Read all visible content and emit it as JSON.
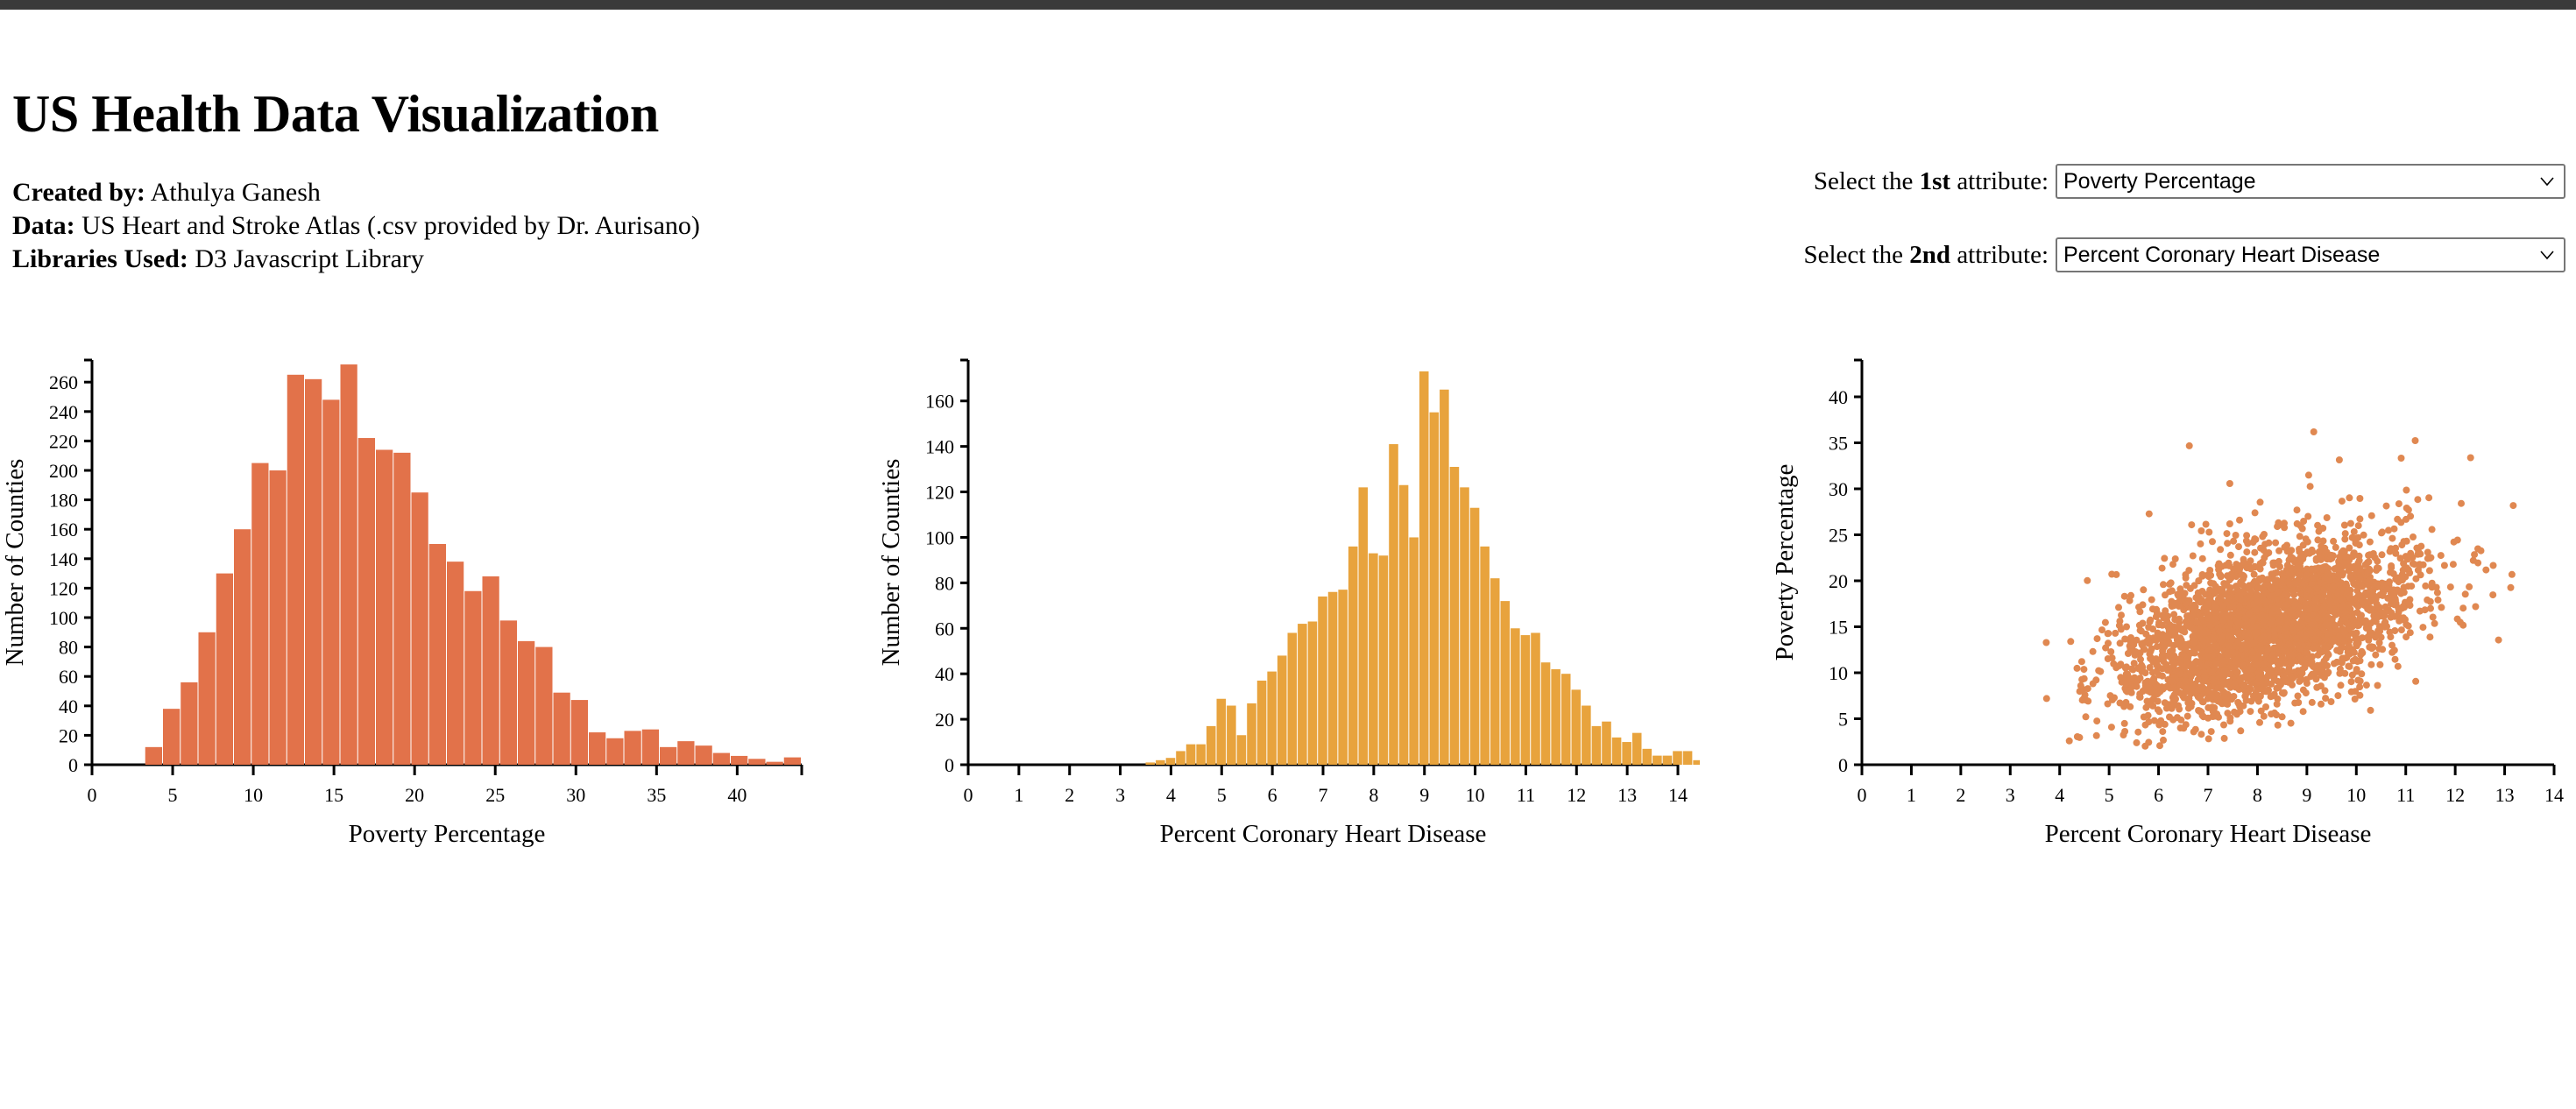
{
  "page": {
    "title": "US Health Data Visualization"
  },
  "meta": {
    "created_by_label": "Created by:",
    "created_by_value": " Athulya Ganesh",
    "data_label": "Data:",
    "data_value": " US Heart and Stroke Atlas (.csv provided by Dr. Aurisano)",
    "libraries_label": "Libraries Used:",
    "libraries_value": " D3 Javascript Library"
  },
  "controls": {
    "first": {
      "label_pre": "Select the ",
      "label_bold": "1st",
      "label_post": " attribute:",
      "value": "Poverty Percentage",
      "caret": "chevron-down-icon"
    },
    "second": {
      "label_pre": "Select the ",
      "label_bold": "2nd",
      "label_post": " attribute:",
      "value": "Percent Coronary Heart Disease",
      "caret": "chevron-down-icon"
    }
  },
  "colors": {
    "hist1": "#e2724a",
    "hist2": "#e8a33d",
    "scatter": "#e08851",
    "axis": "#000000",
    "browser_edge": "#3a3a3a"
  },
  "chart_data": [
    {
      "id": "hist1",
      "type": "bar",
      "title": "",
      "xlabel": "Poverty Percentage",
      "ylabel": "Number of Counties",
      "xlim": [
        0,
        44
      ],
      "ylim": [
        0,
        275
      ],
      "xticks": [
        0,
        5,
        10,
        15,
        20,
        25,
        30,
        35,
        40
      ],
      "yticks": [
        0,
        20,
        40,
        60,
        80,
        100,
        120,
        140,
        160,
        180,
        200,
        220,
        240,
        260
      ],
      "grid": false,
      "bin_width": 1.1,
      "bin_start": 3.3,
      "color": "#e2724a",
      "values": [
        12,
        38,
        56,
        90,
        130,
        160,
        205,
        200,
        265,
        262,
        248,
        272,
        222,
        214,
        212,
        185,
        150,
        138,
        118,
        128,
        98,
        84,
        80,
        49,
        44,
        22,
        18,
        23,
        24,
        12,
        16,
        13,
        8,
        6,
        4,
        2,
        5,
        0,
        0,
        2
      ]
    },
    {
      "id": "hist2",
      "type": "bar",
      "title": "",
      "xlabel": "Percent Coronary Heart Disease",
      "ylabel": "Number of Counties",
      "xlim": [
        0,
        14
      ],
      "ylim": [
        0,
        178
      ],
      "xticks": [
        0,
        1,
        2,
        3,
        4,
        5,
        6,
        7,
        8,
        9,
        10,
        11,
        12,
        13,
        14
      ],
      "yticks": [
        0,
        20,
        40,
        60,
        80,
        100,
        120,
        140,
        160
      ],
      "grid": false,
      "bin_width": 0.2,
      "bin_start": 3.5,
      "color": "#e8a33d",
      "values": [
        1,
        2,
        3,
        6,
        9,
        9,
        17,
        29,
        26,
        13,
        27,
        37,
        41,
        48,
        58,
        62,
        63,
        74,
        76,
        77,
        96,
        122,
        93,
        92,
        141,
        123,
        100,
        173,
        155,
        165,
        131,
        122,
        113,
        96,
        82,
        72,
        60,
        57,
        58,
        45,
        42,
        40,
        33,
        26,
        17,
        19,
        12,
        10,
        14,
        7,
        4,
        4,
        6,
        6,
        2,
        1
      ]
    },
    {
      "id": "scatter",
      "type": "scatter",
      "title": "",
      "xlabel": "Percent Coronary Heart Disease",
      "ylabel": "Poverty Percentage",
      "xlim": [
        0,
        14
      ],
      "ylim": [
        0,
        44
      ],
      "xticks": [
        0,
        1,
        2,
        3,
        4,
        5,
        6,
        7,
        8,
        9,
        10,
        11,
        12,
        13,
        14
      ],
      "yticks": [
        0,
        5,
        10,
        15,
        20,
        25,
        30,
        35,
        40
      ],
      "grid": false,
      "color": "#e08851",
      "point_radius": 4,
      "n_points": 3100,
      "x_mean": 8.2,
      "x_sd": 1.45,
      "y_intercept": 2.0,
      "y_slope": 1.55,
      "y_resid_sd": 4.0,
      "x_min": 3.6,
      "x_max": 14.0,
      "y_min": 2.0,
      "y_max": 43.5
    }
  ]
}
